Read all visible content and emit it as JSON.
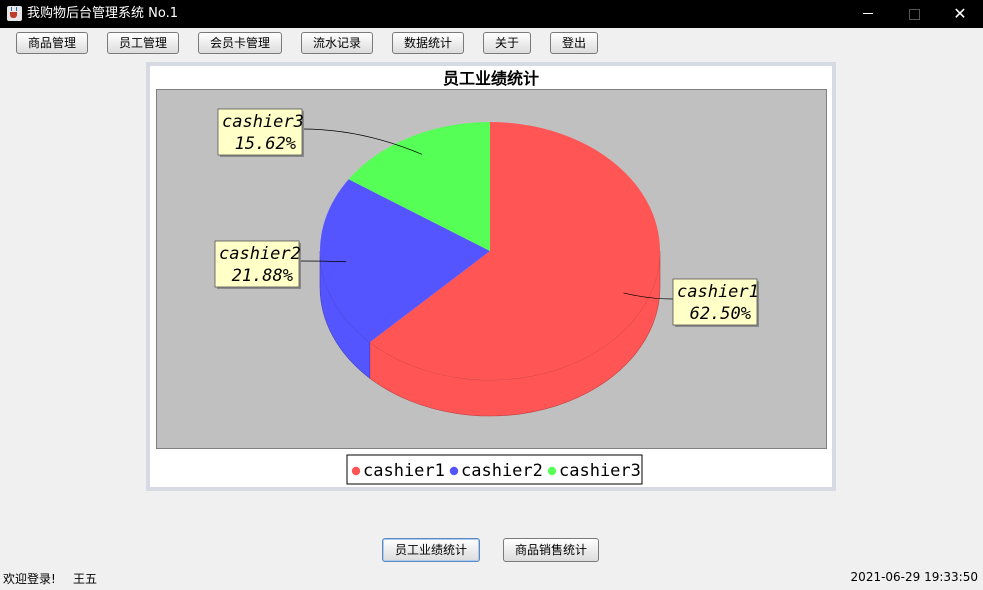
{
  "window": {
    "title": "我购物后台管理系统 No.1",
    "minimize_glyph": "",
    "close_glyph": "✕"
  },
  "menu": {
    "items": [
      "商品管理",
      "员工管理",
      "会员卡管理",
      "流水记录",
      "数据统计",
      "关于",
      "登出"
    ]
  },
  "chart_data": {
    "type": "pie",
    "title": "员工业绩统计",
    "background": "#c0c0c0",
    "slices": [
      {
        "label": "cashier1",
        "value": 62.5,
        "percent_label": "62.50%",
        "color": "#ff5555"
      },
      {
        "label": "cashier2",
        "value": 21.88,
        "percent_label": "21.88%",
        "color": "#5555ff"
      },
      {
        "label": "cashier3",
        "value": 15.62,
        "percent_label": "15.62%",
        "color": "#55ff55"
      }
    ],
    "legend_position": "bottom",
    "three_d": true
  },
  "bottom_buttons": {
    "staff_stats": "员工业绩统计",
    "sales_stats": "商品销售统计"
  },
  "status": {
    "welcome": "欢迎登录!",
    "user": "王五",
    "datetime": "2021-06-29 19:33:50"
  },
  "icons": {
    "app": "java-cup-icon",
    "minimize": "minimize-icon",
    "maximize": "maximize-icon",
    "close": "close-icon"
  }
}
